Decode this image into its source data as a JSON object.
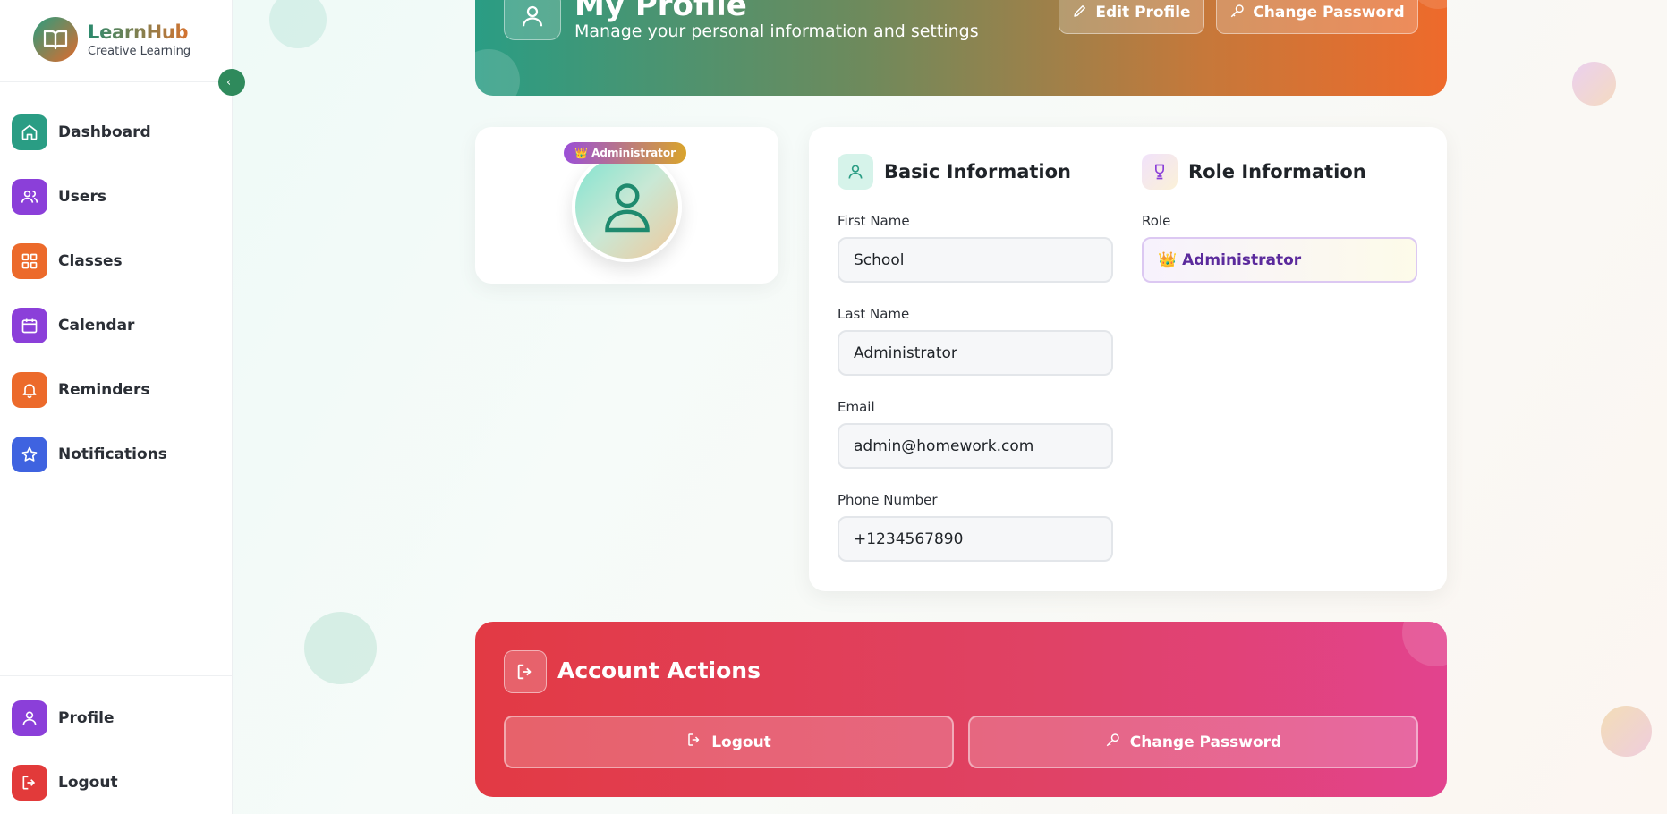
{
  "brand": {
    "title": "LearnHub",
    "subtitle": "Creative Learning"
  },
  "sidebar": {
    "items": [
      {
        "label": "Dashboard",
        "icon": "home-icon",
        "color": "#2a9d84"
      },
      {
        "label": "Users",
        "icon": "users-icon",
        "color": "#8b3fd9"
      },
      {
        "label": "Classes",
        "icon": "grid-icon",
        "color": "#ec6a2b"
      },
      {
        "label": "Calendar",
        "icon": "calendar-icon",
        "color": "#8b3fd9"
      },
      {
        "label": "Reminders",
        "icon": "bell-icon",
        "color": "#ec6a2b"
      },
      {
        "label": "Notifications",
        "icon": "star-icon",
        "color": "#3f63e0"
      }
    ],
    "bottom": [
      {
        "label": "Profile",
        "icon": "user-icon",
        "color": "#8b3fd9"
      },
      {
        "label": "Logout",
        "icon": "logout-icon",
        "color": "#e23a3a"
      }
    ]
  },
  "header": {
    "title": "My Profile",
    "subtitle": "Manage your personal information and settings",
    "edit_label": "Edit Profile",
    "change_password_label": "Change Password"
  },
  "avatar": {
    "badge": "👑 Administrator"
  },
  "basic_info": {
    "title": "Basic Information",
    "first_name": {
      "label": "First Name",
      "value": "School"
    },
    "last_name": {
      "label": "Last Name",
      "value": "Administrator"
    },
    "email": {
      "label": "Email",
      "value": "admin@homework.com"
    },
    "phone": {
      "label": "Phone Number",
      "value": "+1234567890"
    }
  },
  "role_info": {
    "title": "Role Information",
    "role": {
      "label": "Role",
      "value": "👑 Administrator"
    }
  },
  "actions": {
    "title": "Account Actions",
    "logout_label": "Logout",
    "change_password_label": "Change Password"
  }
}
